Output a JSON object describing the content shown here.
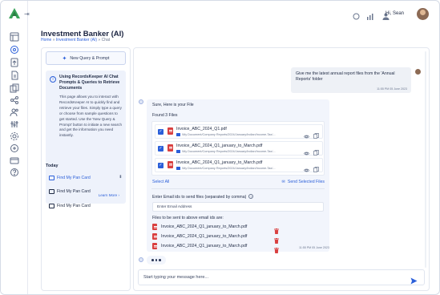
{
  "colors": {
    "accent": "#2b5fd9",
    "logo": "#3aa35a",
    "pdf": "#d94040"
  },
  "header": {
    "greeting": "Hi, Sean",
    "icons": [
      "brightness-icon",
      "chart-icon",
      "user-icon"
    ]
  },
  "page": {
    "title": "Investment Banker (AI)",
    "breadcrumb_home": "Home",
    "breadcrumb_sep": " » ",
    "breadcrumb_mid": "Investment Banker (AI)",
    "breadcrumb_sep2": " » ",
    "breadcrumb_current": "Chat"
  },
  "left": {
    "new_button": "New Query & Prompt",
    "info_title": "Using RecordsKeeper AI Chat Prompts & Queries to Retrieve Documents",
    "info_body": "This page allows you to interact with RecordsKeeper AI to quickly find and retrieve your files. Simply type a query or choose from sample questions to get started. Use the 'New Query & Prompt' button to initiate a new search and get the information you need instantly.",
    "learn_more": "Learn More ›",
    "section": "Today",
    "history": [
      {
        "label": "Find My Pan Card"
      },
      {
        "label": "Find My Pan Card"
      },
      {
        "label": "Find My Pan Card"
      }
    ]
  },
  "chat": {
    "user_message": "Give me  the latest annual report files from the 'Annual Reports' folder",
    "user_time": "11:55 PM 05 June 2023",
    "bot_intro": "Sure, Here is your File",
    "found": "Found 3 Files",
    "files": [
      {
        "name": "Invoice_ABC_2024_Q1.pdf",
        "path": "/My Document/Company Reports/2024/January/Indian/Income-Tax/..."
      },
      {
        "name": "Invoice_ABC_2024_Q1_january_to_March.pdf",
        "path": "/My Document/Company Reports/2024/January/Indian/Income-Tax/..."
      },
      {
        "name": "Invoice_ABC_2024_Q1_january_to_March.pdf",
        "path": "/My Document/Company Reports/2024/January/Indian/Income-Tax/..."
      }
    ],
    "select_all": "Select All",
    "send_selected": "Send Selected Files",
    "email_label": "Enter Email ids to send files (separated by comma)",
    "email_placeholder": "Enter Email Address",
    "send_label": "Files to be sent to above email ids are:",
    "send_files": [
      {
        "name": "Invoice_ABC_2024_Q1_january_to_March.pdf"
      },
      {
        "name": "Invoice_ABC_2024_Q1_january_to_March.pdf"
      },
      {
        "name": "Invoice_ABC_2024_Q1_january_to_March.pdf"
      }
    ],
    "bot_time": "11:55 PM 05 June 2023",
    "input_placeholder": "Start typing your message here..."
  }
}
